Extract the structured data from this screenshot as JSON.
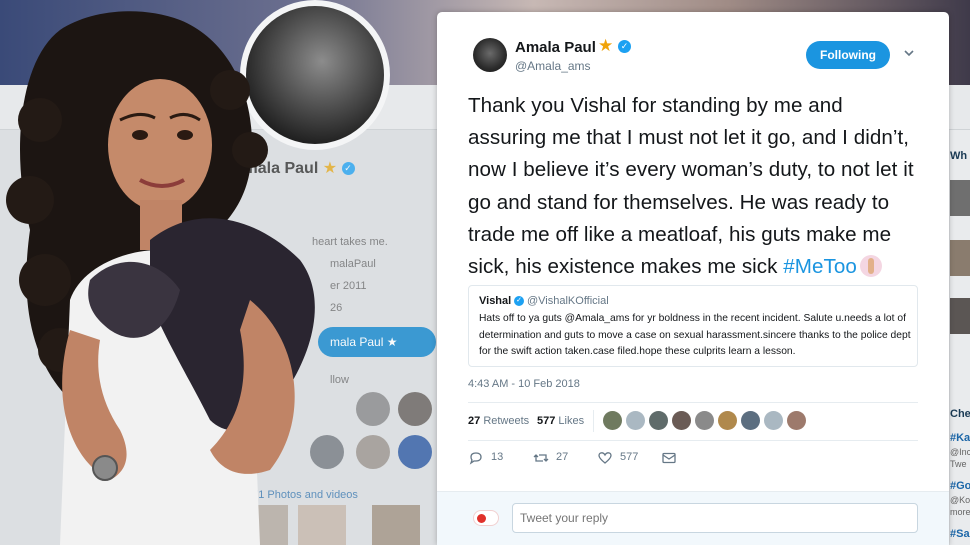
{
  "background": {
    "profile_name": "Amala Paul",
    "bio_fragment": "heart takes me.",
    "handle_fragment": "malaPaul",
    "joined_fragment": "er 2011",
    "birthday_fragment": "26",
    "follow_pill": "mala Paul",
    "follow_fragment": "llow",
    "media_count": "471 Photos and videos",
    "right_heading_1": "Wh",
    "right_heading_2": "Che",
    "right_item_1": "#Ka",
    "right_item_1_sub": "@Inc",
    "right_item_1_sub2": "Twe",
    "right_item_2": "#Go",
    "right_item_2_sub": "@Ko",
    "right_item_2_sub2": "more",
    "right_item_3": "#Sa"
  },
  "tweet": {
    "name": "Amala Paul",
    "handle": "@Amala_ams",
    "follow_label": "Following",
    "text": "Thank you Vishal for standing by me and assuring me that I must not let it go, and I didn’t, now I believe it’s every woman’s duty, to not let it go and stand for themselves. He was ready to trade me off like a meatloaf, his guts make me sick, his existence makes me sick",
    "hashtag": "#MeToo",
    "quote": {
      "name": "Vishal",
      "handle": "@VishalKOfficial",
      "text": "Hats off to ya guts @Amala_ams for yr boldness in the recent incident. Salute u.needs a lot of determination and guts to move a case on sexual harassment.sincere thanks to the police dept for the swift action taken.case filed.hope these culprits learn a lesson."
    },
    "timestamp": "4:43 AM - 10 Feb 2018",
    "retweets_count": "27",
    "retweets_label": "Retweets",
    "likes_count": "577",
    "likes_label": "Likes",
    "replies": "13",
    "retweets": "27",
    "likes": "577",
    "reply_placeholder": "Tweet your reply"
  },
  "colors": {
    "accent": "#1b95e0",
    "star": "#f0a30a",
    "muted": "#657786"
  },
  "icons": [
    "star-icon",
    "verified-icon",
    "chevron-down-icon",
    "reply-icon",
    "retweet-icon",
    "heart-icon",
    "message-icon"
  ]
}
